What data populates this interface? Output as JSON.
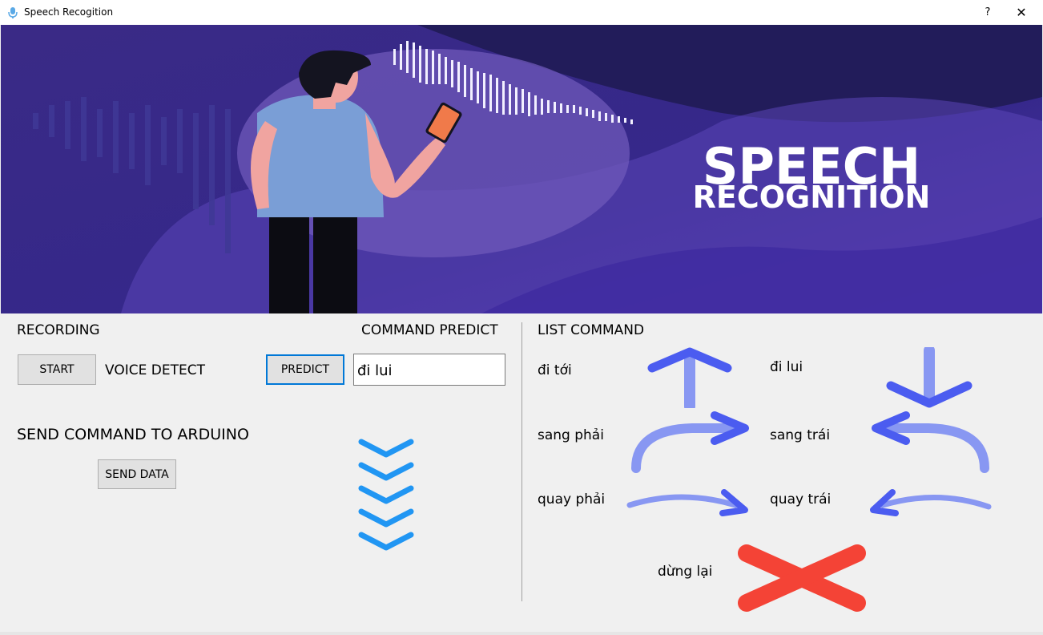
{
  "window": {
    "title": "Speech Recogition",
    "help_label": "?",
    "close_label": "✕"
  },
  "banner": {
    "line1": "SPEECH",
    "line2": "RECOGNITION"
  },
  "recording": {
    "heading": "RECORDING",
    "start_label": "START",
    "voice_detect_label": "VOICE DETECT"
  },
  "predict": {
    "heading": "COMMAND PREDICT",
    "predict_label": "PREDICT",
    "result_value": "đi lui"
  },
  "send": {
    "heading": "SEND COMMAND TO ARDUINO",
    "send_label": "SEND DATA"
  },
  "commands": {
    "heading": "LIST COMMAND",
    "forward": "đi tới",
    "backward": "đi lui",
    "right": "sang phải",
    "left": "sang trái",
    "turn_right": "quay phải",
    "turn_left": "quay trái",
    "stop": "dừng lại"
  },
  "colors": {
    "banner_bg": "#3b2d8c",
    "arrow_blue": "#4b5cf0",
    "chevron_blue": "#2196f3",
    "stop_red": "#f44336",
    "focus_border": "#0078d7"
  }
}
